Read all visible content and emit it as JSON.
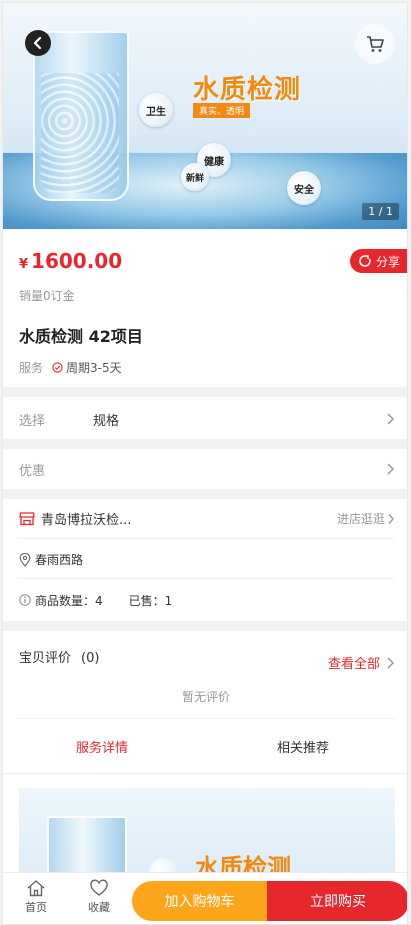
{
  "hero": {
    "headline": "水质检测",
    "subline": "真实、透明",
    "badges": [
      "卫生",
      "健康",
      "新鲜",
      "安全"
    ],
    "page_indicator": "1 / 1"
  },
  "product": {
    "currency": "¥",
    "price": "1600.00",
    "share_label": "分享",
    "sales": "销量0订金",
    "title": "水质检测 42项目",
    "service_label": "服务",
    "cycle": "周期3-5天"
  },
  "options": {
    "select_label": "选择",
    "select_value": "规格",
    "discount_label": "优惠"
  },
  "shop": {
    "name": "青岛博拉沃检...",
    "enter_label": "进店逛逛",
    "address": "春雨西路",
    "count_label": "商品数量：4",
    "sold_label": "已售：1"
  },
  "reviews": {
    "title": "宝贝评价",
    "count": "(0)",
    "view_all": "查看全部",
    "empty": "暂无评价"
  },
  "tabs": {
    "details": "服务详情",
    "related": "相关推荐"
  },
  "detail": {
    "headline": "水质检测"
  },
  "bottom_bar": {
    "home": "首页",
    "favorite": "收藏",
    "add_to_cart": "加入购物车",
    "buy_now": "立即购买"
  },
  "colors": {
    "accent": "#e6282d",
    "cart_button": "#fda61c",
    "banner_text": "#f08a12"
  }
}
